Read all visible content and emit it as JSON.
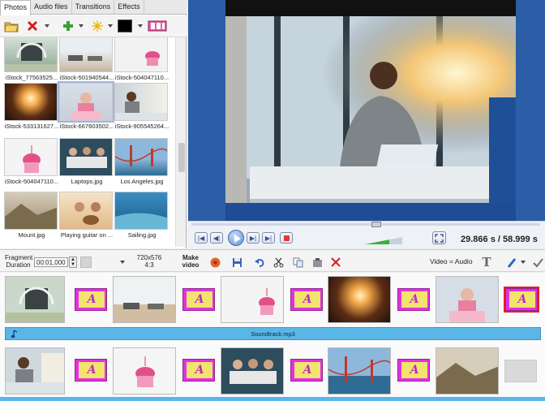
{
  "left_panel": {
    "tabs": [
      {
        "label": "Photos",
        "active": true
      },
      {
        "label": "Audio files",
        "active": false
      },
      {
        "label": "Transitions",
        "active": false
      },
      {
        "label": "Effects",
        "active": false
      }
    ],
    "thumbnails": [
      {
        "caption": "iStock_77563525...",
        "image": "headphones-photo"
      },
      {
        "caption": "iStock-501940544...",
        "image": "car-panorama-photo"
      },
      {
        "caption": "iStock-504047110...",
        "image": "cupcake-photo"
      },
      {
        "caption": "iStock-533131627...",
        "image": "cave-photo"
      },
      {
        "caption": "iStock-667603502...",
        "image": "baby-cake-photo"
      },
      {
        "caption": "iStock-905545264...",
        "image": "man-laptop-photo"
      },
      {
        "caption": "iStock-504047110...",
        "image": "cupcake-photo"
      },
      {
        "caption": "Laptops.jpg",
        "image": "laptops-photo"
      },
      {
        "caption": "Los Angeles.jpg",
        "image": "golden-gate-photo"
      },
      {
        "caption": "Mount.jpg",
        "image": "mountain-photo"
      },
      {
        "caption": "Playing guitar on ...",
        "image": "guitar-photo"
      },
      {
        "caption": "Sailing.jpg",
        "image": "sailing-photo"
      }
    ]
  },
  "player": {
    "time_current": "29.866 s",
    "time_separator": "/",
    "time_total": "58.999 s"
  },
  "toolbar": {
    "fragment_label_1": "Fragment",
    "fragment_label_2": "Duration",
    "duration_value": "00:01,000",
    "resolution_1": "720x576",
    "resolution_2": "4:3",
    "make_video_1": "Make",
    "make_video_2": "video",
    "video_audio": "Video = Audio"
  },
  "timeline": {
    "audio_track": "Soundtrack.mp3",
    "transition_glyph": "A"
  },
  "colors": {
    "preview_bg": "#2b5ea6",
    "audio_track": "#5ab6e6",
    "transition_fill": "#e62ee6",
    "transition_inner": "#f1e46c"
  }
}
